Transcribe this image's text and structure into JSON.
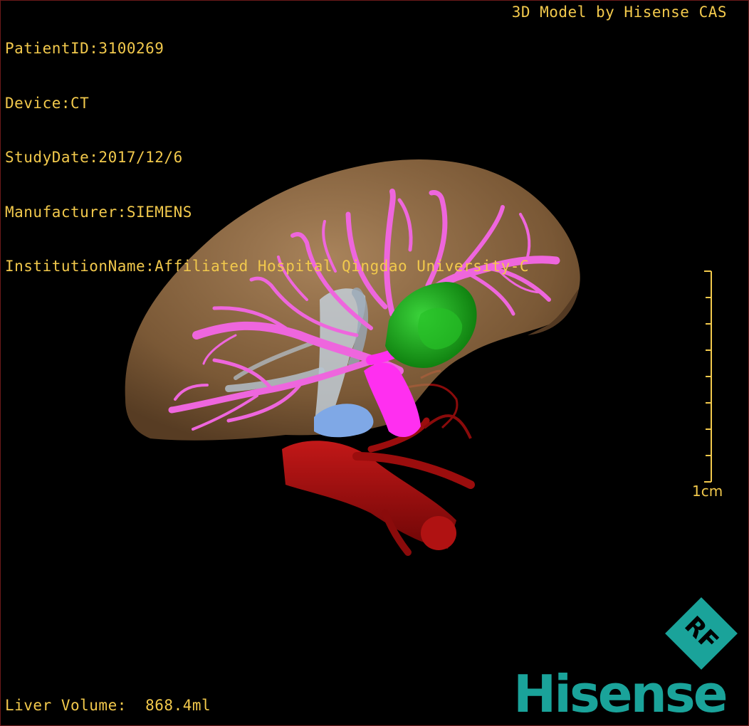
{
  "info": {
    "patient_id": "PatientID:3100269",
    "device": "Device:CT",
    "study_date": "StudyDate:2017/12/6",
    "manufacturer": "Manufacturer:SIEMENS",
    "institution": "InstitutionName:Affiliated Hospital Qingdao University-C"
  },
  "header": {
    "model_credit": "3D Model by Hisense CAS"
  },
  "scale_bar": {
    "label": "1cm"
  },
  "footer": {
    "liver_volume": "Liver Volume:  868.4ml"
  },
  "logo": {
    "emblem_text": "RF",
    "brand_text": "Hisense"
  },
  "colors": {
    "overlay_text": "#f2c94c",
    "liver": "#b8875a",
    "hepatic_vessels": "#ee66dd",
    "portal_vein": "#ff2ff0",
    "tumor": "#1fae1f",
    "aorta": "#a00d0d",
    "vena_cava": "#c6d3e0",
    "kidney_region": "#7fa8e6",
    "brand": "#1aa39a"
  }
}
